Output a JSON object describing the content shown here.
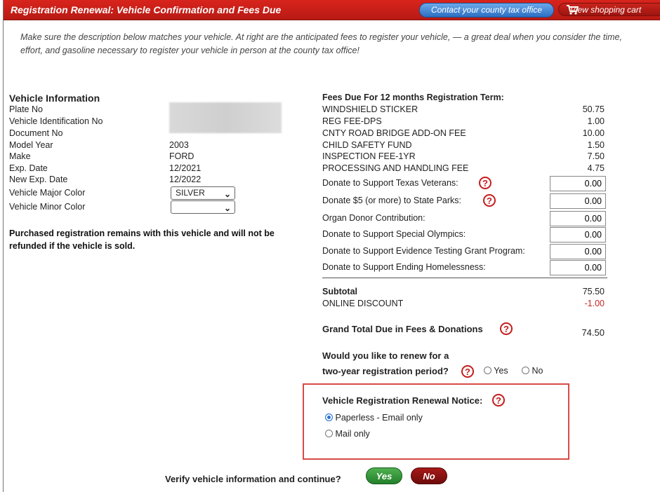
{
  "header": {
    "title": "Registration Renewal: Vehicle Confirmation and Fees Due",
    "contact_link": "Contact your county tax office",
    "cart_link": "View shopping cart"
  },
  "intro": "Make sure the description below matches your vehicle. At right are the anticipated fees to register your vehicle, — a great deal when you consider the time, effort, and gasoline necessary to register your vehicle in person at the county tax office!",
  "vehicle": {
    "heading": "Vehicle Information",
    "labels": {
      "plate": "Plate No",
      "vin": "Vehicle Identification No",
      "document": "Document No",
      "model_year": "Model Year",
      "make": "Make",
      "exp": "Exp. Date",
      "new_exp": "New Exp. Date",
      "major_color": "Vehicle Major Color",
      "minor_color": "Vehicle Minor Color"
    },
    "values": {
      "model_year": "2003",
      "make": "FORD",
      "exp": "12/2021",
      "new_exp": "12/2022"
    },
    "major_color_value": "SILVER",
    "minor_color_value": ""
  },
  "warning": "Purchased registration remains with this vehicle and will not be refunded if the vehicle is sold.",
  "fees": {
    "heading": "Fees Due For 12 months Registration Term:",
    "items": [
      {
        "label": "WINDSHIELD STICKER",
        "value": "50.75"
      },
      {
        "label": "REG FEE-DPS",
        "value": "1.00"
      },
      {
        "label": "CNTY ROAD BRIDGE ADD-ON FEE",
        "value": "10.00"
      },
      {
        "label": "CHILD SAFETY FUND",
        "value": "1.50"
      },
      {
        "label": "INSPECTION FEE-1YR",
        "value": "7.50"
      },
      {
        "label": "PROCESSING AND HANDLING FEE",
        "value": "4.75"
      }
    ],
    "donations": [
      {
        "label": "Donate to Support Texas Veterans:",
        "value": "0.00"
      },
      {
        "label": "Donate $5 (or more) to State Parks:",
        "value": "0.00"
      },
      {
        "label": "Organ Donor Contribution:",
        "value": "0.00"
      },
      {
        "label": "Donate to Support Special Olympics:",
        "value": "0.00"
      },
      {
        "label": "Donate to Support Evidence Testing Grant Program:",
        "value": "0.00"
      },
      {
        "label": "Donate to Support Ending Homelessness:",
        "value": "0.00"
      }
    ],
    "subtotal_label": "Subtotal",
    "subtotal_value": "75.50",
    "discount_label": "ONLINE DISCOUNT",
    "discount_value": "-1.00",
    "grand_total_label": "Grand Total Due in Fees & Donations",
    "grand_total_value": "74.50",
    "two_year_line1": "Would you like to renew for a",
    "two_year_line2": "two-year registration period?",
    "yes": "Yes",
    "no": "No"
  },
  "notice": {
    "heading": "Vehicle Registration Renewal Notice:",
    "option1": "Paperless - Email only",
    "option2": "Mail only"
  },
  "verify": {
    "text": "Verify vehicle information and continue?",
    "yes": "Yes",
    "no": "No"
  },
  "colors": {
    "header_red": "#c61f18",
    "accent_blue": "#2d6fc2",
    "help_red": "#c51d1d",
    "discount_red": "#c62828"
  }
}
